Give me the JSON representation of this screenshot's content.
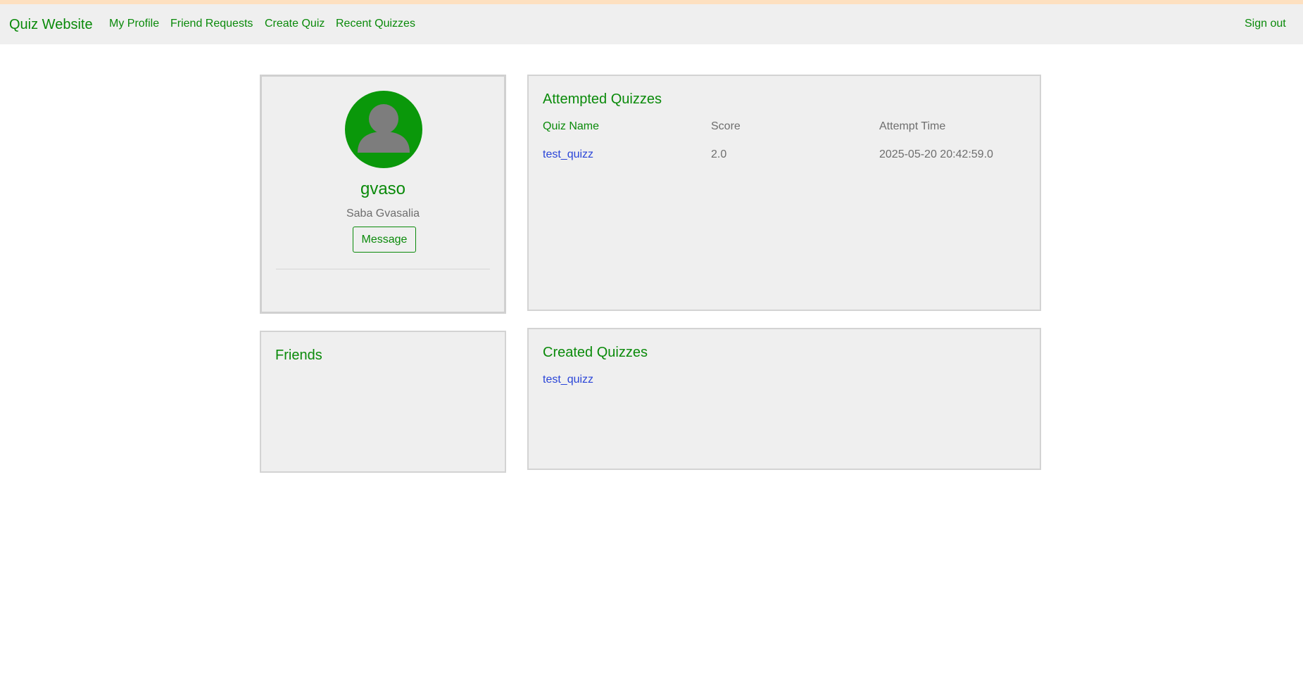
{
  "nav": {
    "brand": "Quiz Website",
    "links": [
      "My Profile",
      "Friend Requests",
      "Create Quiz",
      "Recent Quizzes"
    ],
    "signout": "Sign out"
  },
  "profile": {
    "avatar_icon": "user-avatar-icon",
    "username": "gvaso",
    "full_name": "Saba Gvasalia",
    "message_button": "Message"
  },
  "friends": {
    "title": "Friends"
  },
  "attempted": {
    "title": "Attempted Quizzes",
    "headers": [
      "Quiz Name",
      "Score",
      "Attempt Time"
    ],
    "rows": [
      {
        "quiz_name": "test_quizz",
        "score": "2.0",
        "attempt_time": "2025-05-20 20:42:59.0"
      }
    ]
  },
  "created": {
    "title": "Created Quizzes",
    "quizzes": [
      "test_quizz"
    ]
  },
  "colors": {
    "accent": "#0a8a0a",
    "avatar_bg": "#0a980a",
    "link": "#2a45d8",
    "card_bg": "#efefef",
    "top_strip": "#fde0c0"
  }
}
